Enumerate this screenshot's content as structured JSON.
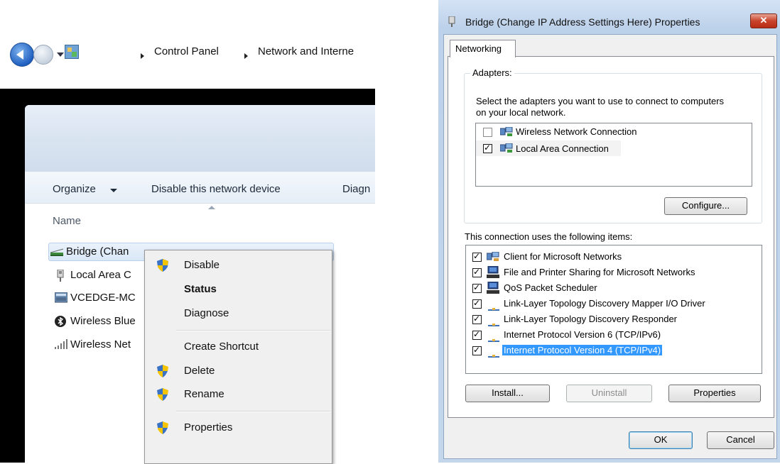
{
  "explorer": {
    "breadcrumb": [
      "Control Panel",
      "Network and Interne"
    ],
    "commands": {
      "organize": "Organize",
      "disable": "Disable this network device",
      "diagnose": "Diagn"
    },
    "column_name": "Name",
    "rows": [
      {
        "label": "Bridge (Chan",
        "icon": "bridge-icon"
      },
      {
        "label": "Local Area C",
        "icon": "network-adapter-icon"
      },
      {
        "label": "VCEDGE-MC",
        "icon": "vpn-adapter-icon"
      },
      {
        "label": "Wireless Blue",
        "icon": "bluetooth-icon"
      },
      {
        "label": "Wireless Net",
        "icon": "wireless-signal-icon"
      }
    ]
  },
  "context_menu": {
    "items": [
      {
        "label": "Disable",
        "shield": true
      },
      {
        "label": "Status",
        "shield": false,
        "bold": true
      },
      {
        "label": "Diagnose",
        "shield": false
      },
      {
        "label": "Create Shortcut",
        "shield": false
      },
      {
        "label": "Delete",
        "shield": true
      },
      {
        "label": "Rename",
        "shield": true
      },
      {
        "label": "Properties",
        "shield": true
      }
    ]
  },
  "dialog": {
    "title": "Bridge (Change IP Address Settings Here) Properties",
    "close_label": "✕",
    "tab": "Networking",
    "adapters_legend": "Adapters:",
    "adapters_desc_1": "Select the adapters you want to use to connect to computers",
    "adapters_desc_2": "on your local network.",
    "adapters": [
      {
        "label": "Wireless Network Connection",
        "checked": false
      },
      {
        "label": "Local Area Connection",
        "checked": true
      }
    ],
    "configure_label": "Configure...",
    "items_caption": "This connection uses the following items:",
    "items": [
      {
        "label": "Client for Microsoft Networks",
        "checked": true
      },
      {
        "label": "File and Printer Sharing for Microsoft Networks",
        "checked": true
      },
      {
        "label": "QoS Packet Scheduler",
        "checked": true
      },
      {
        "label": "Link-Layer Topology Discovery Mapper I/O Driver",
        "checked": true
      },
      {
        "label": "Link-Layer Topology Discovery Responder",
        "checked": true
      },
      {
        "label": "Internet Protocol Version 6 (TCP/IPv6)",
        "checked": true
      },
      {
        "label": "Internet Protocol Version 4 (TCP/IPv4)",
        "checked": true,
        "selected": true
      }
    ],
    "install_label": "Install...",
    "uninstall_label": "Uninstall",
    "properties_label": "Properties",
    "ok_label": "OK",
    "cancel_label": "Cancel"
  },
  "colors": {
    "selection": "#3399ff",
    "close_button": "#c9432c",
    "title_gradient": "#bcd1ea"
  }
}
